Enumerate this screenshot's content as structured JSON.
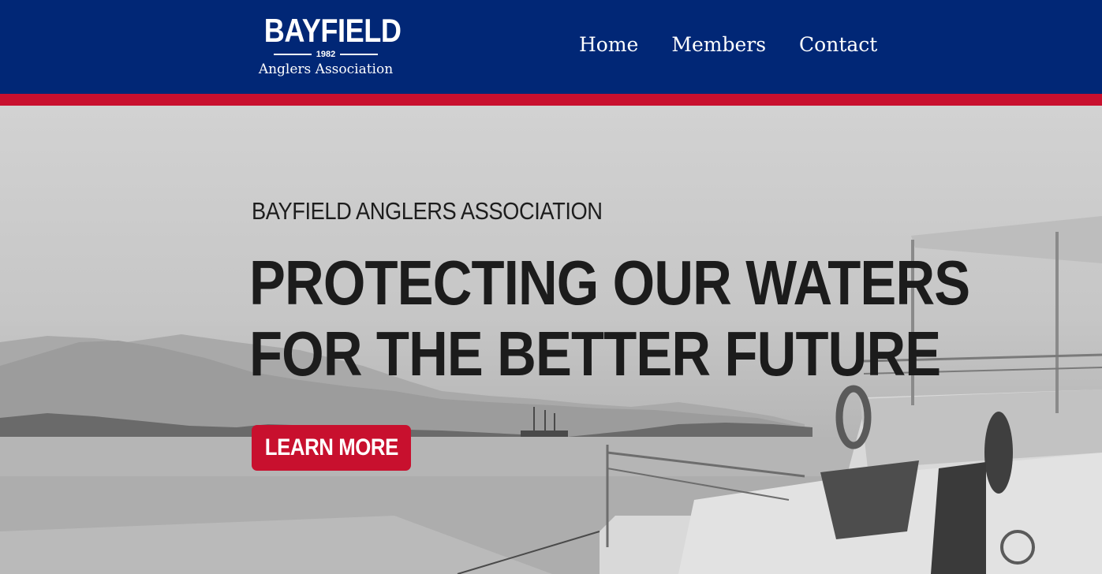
{
  "header": {
    "logo": {
      "word": "BAYFIELD",
      "year": "1982",
      "subtitle": "Anglers Association"
    },
    "nav": [
      {
        "label": "Home"
      },
      {
        "label": "Members"
      },
      {
        "label": "Contact"
      }
    ]
  },
  "hero": {
    "subtitle": "BAYFIELD ANGLERS ASSOCIATION",
    "title_line1": "PROTECTING OUR WATERS",
    "title_line2": "FOR THE BETTER FUTURE",
    "cta_label": "LEARN MORE"
  },
  "colors": {
    "header_bg": "#012776",
    "accent_red": "#c8102e",
    "text_dark": "#1c1c1c"
  }
}
